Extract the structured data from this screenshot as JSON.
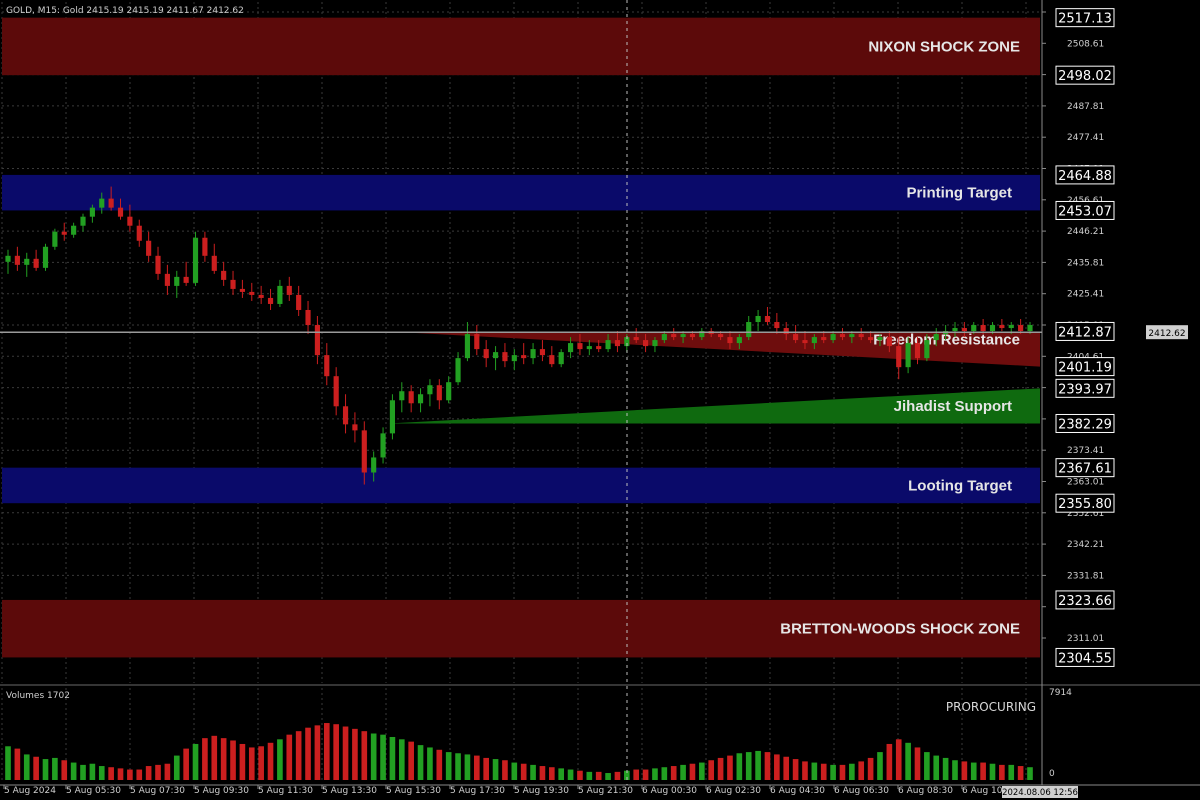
{
  "header": {
    "symbol_info": "GOLD, M15:  Gold  2415.19 2415.19 2411.67 2412.62"
  },
  "volume_panel": {
    "title": "Volumes 1702",
    "indicator_label": "PROROCURING",
    "max_label": "7914",
    "zero_label": "0"
  },
  "colors": {
    "background": "#000000",
    "grid": "#3a3a3a",
    "bull": "#22a022",
    "bear": "#cc1f1f",
    "zone_red": "#5c0a0a",
    "zone_blue": "#0a0a6a",
    "wedge_red": "#6e0d0d",
    "wedge_green": "#0f6a0f",
    "price_line": "#9a9a9a"
  },
  "price_axis": {
    "ticks": [
      "2519.01",
      "2508.61",
      "2498.21",
      "2487.81",
      "2477.41",
      "2467.01",
      "2456.61",
      "2446.21",
      "2435.81",
      "2425.41",
      "2415.01",
      "2404.61",
      "2394.21",
      "2383.81",
      "2373.41",
      "2363.01",
      "2352.61",
      "2342.21",
      "2331.81",
      "2321.41",
      "2311.01"
    ],
    "current_price": "2412.62"
  },
  "time_axis": {
    "labels": [
      "5 Aug 2024",
      "5 Aug 05:30",
      "5 Aug 07:30",
      "5 Aug 09:30",
      "5 Aug 11:30",
      "5 Aug 13:30",
      "5 Aug 15:30",
      "5 Aug 17:30",
      "5 Aug 19:30",
      "5 Aug 21:30",
      "6 Aug 00:30",
      "6 Aug 02:30",
      "6 Aug 04:30",
      "6 Aug 06:30",
      "6 Aug 08:30",
      "6 Aug 10"
    ],
    "cursor_time": "2024.08.06 12:56"
  },
  "zones": [
    {
      "label": "NIXON SHOCK ZONE",
      "kind": "red",
      "top": "2517.13",
      "bottom": "2498.02"
    },
    {
      "label": "Printing Target",
      "kind": "blue",
      "top": "2464.88",
      "bottom": "2453.07"
    },
    {
      "label": "Freedom Resistance",
      "kind": "wedge-red",
      "top": "2412.87",
      "bottom": "2401.19"
    },
    {
      "label": "Jihadist Support",
      "kind": "wedge-green",
      "top": "2393.97",
      "bottom": "2382.29"
    },
    {
      "label": "Looting Target",
      "kind": "blue",
      "top": "2367.61",
      "bottom": "2355.80"
    },
    {
      "label": "BRETTON-WOODS SHOCK ZONE",
      "kind": "red",
      "top": "2323.66",
      "bottom": "2304.55"
    }
  ],
  "chart_data": {
    "type": "candlestick",
    "symbol": "GOLD",
    "timeframe": "M15",
    "ylim": [
      2305,
      2522
    ],
    "candles": [
      [
        2436,
        2440,
        2432,
        2438
      ],
      [
        2438,
        2441,
        2433,
        2435
      ],
      [
        2435,
        2439,
        2431,
        2437
      ],
      [
        2437,
        2440,
        2433,
        2434
      ],
      [
        2434,
        2442,
        2433,
        2441
      ],
      [
        2441,
        2447,
        2440,
        2446
      ],
      [
        2446,
        2449,
        2443,
        2445
      ],
      [
        2445,
        2449,
        2444,
        2448
      ],
      [
        2448,
        2452,
        2446,
        2451
      ],
      [
        2451,
        2455,
        2449,
        2454
      ],
      [
        2454,
        2459,
        2452,
        2457
      ],
      [
        2457,
        2461,
        2453,
        2454
      ],
      [
        2454,
        2457,
        2450,
        2451
      ],
      [
        2451,
        2455,
        2446,
        2448
      ],
      [
        2448,
        2450,
        2441,
        2443
      ],
      [
        2443,
        2446,
        2436,
        2438
      ],
      [
        2438,
        2441,
        2430,
        2432
      ],
      [
        2432,
        2435,
        2425,
        2428
      ],
      [
        2428,
        2433,
        2424,
        2431
      ],
      [
        2431,
        2436,
        2428,
        2429
      ],
      [
        2429,
        2446,
        2428,
        2444
      ],
      [
        2444,
        2446,
        2436,
        2438
      ],
      [
        2438,
        2442,
        2432,
        2433
      ],
      [
        2433,
        2436,
        2428,
        2430
      ],
      [
        2430,
        2433,
        2425,
        2427
      ],
      [
        2427,
        2430,
        2424,
        2426
      ],
      [
        2426,
        2429,
        2423,
        2425
      ],
      [
        2425,
        2428,
        2422,
        2424
      ],
      [
        2424,
        2427,
        2420,
        2422
      ],
      [
        2422,
        2430,
        2421,
        2428
      ],
      [
        2428,
        2431,
        2423,
        2425
      ],
      [
        2425,
        2428,
        2418,
        2420
      ],
      [
        2420,
        2423,
        2412,
        2415
      ],
      [
        2415,
        2418,
        2402,
        2405
      ],
      [
        2405,
        2409,
        2395,
        2398
      ],
      [
        2398,
        2401,
        2385,
        2388
      ],
      [
        2388,
        2392,
        2379,
        2382
      ],
      [
        2382,
        2386,
        2376,
        2380
      ],
      [
        2380,
        2383,
        2362,
        2366
      ],
      [
        2366,
        2373,
        2363,
        2371
      ],
      [
        2371,
        2381,
        2369,
        2379
      ],
      [
        2379,
        2392,
        2377,
        2390
      ],
      [
        2390,
        2396,
        2386,
        2393
      ],
      [
        2393,
        2395,
        2386,
        2389
      ],
      [
        2389,
        2394,
        2386,
        2392
      ],
      [
        2392,
        2397,
        2388,
        2395
      ],
      [
        2395,
        2397,
        2387,
        2390
      ],
      [
        2390,
        2398,
        2389,
        2396
      ],
      [
        2396,
        2406,
        2395,
        2404
      ],
      [
        2404,
        2416,
        2403,
        2412
      ],
      [
        2412,
        2415,
        2405,
        2407
      ],
      [
        2407,
        2410,
        2401,
        2404
      ],
      [
        2404,
        2408,
        2400,
        2406
      ],
      [
        2406,
        2409,
        2401,
        2403
      ],
      [
        2403,
        2407,
        2400,
        2405
      ],
      [
        2405,
        2409,
        2402,
        2404
      ],
      [
        2404,
        2409,
        2402,
        2407
      ],
      [
        2407,
        2410,
        2403,
        2405
      ],
      [
        2405,
        2408,
        2401,
        2402
      ],
      [
        2402,
        2407,
        2401,
        2406
      ],
      [
        2406,
        2411,
        2404,
        2409
      ],
      [
        2409,
        2412,
        2405,
        2407
      ],
      [
        2407,
        2410,
        2405,
        2408
      ],
      [
        2408,
        2410,
        2406,
        2407
      ],
      [
        2407,
        2412,
        2406,
        2410
      ],
      [
        2410,
        2413,
        2406,
        2408
      ],
      [
        2408,
        2412,
        2406,
        2411
      ],
      [
        2411,
        2414,
        2409,
        2410
      ],
      [
        2410,
        2412,
        2406,
        2408
      ],
      [
        2408,
        2411,
        2406,
        2410
      ],
      [
        2410,
        2413,
        2409,
        2412
      ],
      [
        2412,
        2414,
        2410,
        2411
      ],
      [
        2411,
        2413,
        2409,
        2412
      ],
      [
        2412,
        2413,
        2410,
        2411
      ],
      [
        2411,
        2414,
        2410,
        2413
      ],
      [
        2413,
        2414,
        2411,
        2412
      ],
      [
        2412,
        2413,
        2410,
        2411
      ],
      [
        2411,
        2413,
        2407,
        2409
      ],
      [
        2409,
        2412,
        2407,
        2411
      ],
      [
        2411,
        2418,
        2410,
        2416
      ],
      [
        2416,
        2420,
        2413,
        2418
      ],
      [
        2418,
        2421,
        2415,
        2416
      ],
      [
        2416,
        2419,
        2412,
        2414
      ],
      [
        2414,
        2416,
        2410,
        2412
      ],
      [
        2412,
        2415,
        2409,
        2410
      ],
      [
        2410,
        2413,
        2407,
        2409
      ],
      [
        2409,
        2412,
        2407,
        2411
      ],
      [
        2411,
        2413,
        2409,
        2410
      ],
      [
        2410,
        2413,
        2409,
        2412
      ],
      [
        2412,
        2414,
        2410,
        2411
      ],
      [
        2411,
        2413,
        2409,
        2412
      ],
      [
        2412,
        2414,
        2410,
        2411
      ],
      [
        2411,
        2413,
        2409,
        2410
      ],
      [
        2410,
        2412,
        2408,
        2411
      ],
      [
        2411,
        2413,
        2406,
        2408
      ],
      [
        2408,
        2411,
        2397,
        2401
      ],
      [
        2401,
        2411,
        2399,
        2409
      ],
      [
        2409,
        2411,
        2402,
        2404
      ],
      [
        2404,
        2412,
        2403,
        2410
      ],
      [
        2410,
        2414,
        2408,
        2412
      ],
      [
        2412,
        2415,
        2410,
        2413
      ],
      [
        2413,
        2416,
        2411,
        2414
      ],
      [
        2414,
        2416,
        2411,
        2413
      ],
      [
        2413,
        2416,
        2412,
        2415
      ],
      [
        2415,
        2417,
        2412,
        2413
      ],
      [
        2413,
        2416,
        2412,
        2415
      ],
      [
        2415,
        2417,
        2413,
        2414
      ],
      [
        2414,
        2416,
        2412,
        2415
      ],
      [
        2415,
        2417,
        2412,
        2413
      ],
      [
        2413,
        2416,
        2412,
        2415
      ]
    ],
    "volumes": [
      2900,
      2700,
      2200,
      2000,
      1800,
      1900,
      1700,
      1500,
      1300,
      1400,
      1200,
      1100,
      1000,
      900,
      900,
      1200,
      1300,
      1400,
      2100,
      2700,
      3100,
      3600,
      3800,
      3600,
      3400,
      3100,
      2800,
      2900,
      3200,
      3500,
      3900,
      4200,
      4500,
      4700,
      4900,
      4800,
      4600,
      4400,
      4200,
      4000,
      3900,
      3700,
      3500,
      3300,
      3000,
      2800,
      2600,
      2400,
      2300,
      2200,
      2100,
      1900,
      1800,
      1700,
      1500,
      1400,
      1300,
      1200,
      1100,
      1000,
      900,
      800,
      700,
      700,
      600,
      700,
      800,
      900,
      900,
      1000,
      1100,
      1200,
      1300,
      1400,
      1500,
      1700,
      1900,
      2100,
      2300,
      2400,
      2500,
      2400,
      2200,
      2000,
      1800,
      1600,
      1500,
      1400,
      1300,
      1300,
      1400,
      1600,
      1900,
      2400,
      3100,
      3500,
      3200,
      2800,
      2400,
      2100,
      1900,
      1700,
      1600,
      1500,
      1500,
      1400,
      1300,
      1300,
      1200,
      1100
    ]
  }
}
